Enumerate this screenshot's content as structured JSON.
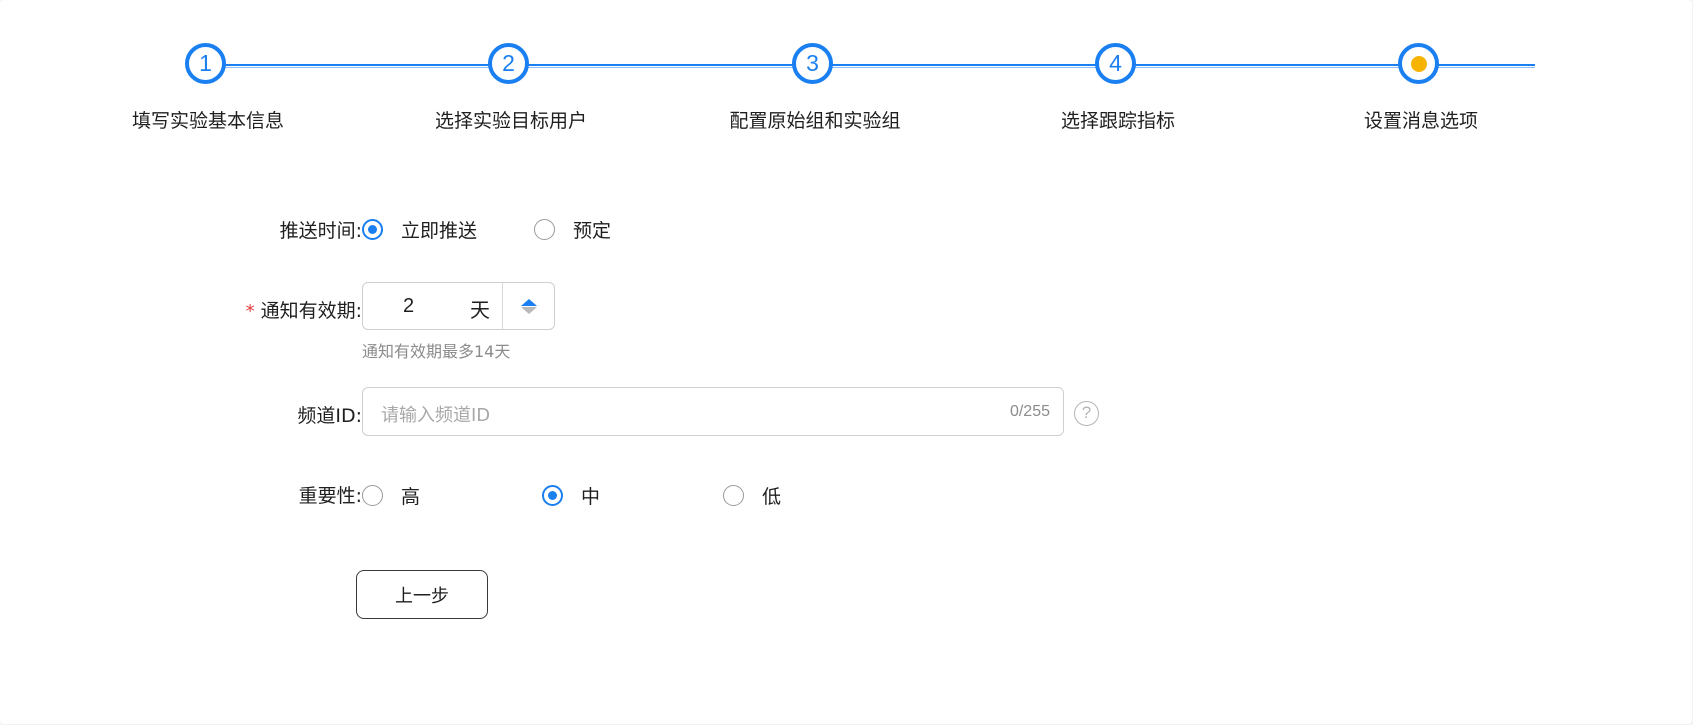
{
  "steps": [
    {
      "number": "1",
      "label": "填写实验基本信息"
    },
    {
      "number": "2",
      "label": "选择实验目标用户"
    },
    {
      "number": "3",
      "label": "配置原始组和实验组"
    },
    {
      "number": "4",
      "label": "选择跟踪指标"
    },
    {
      "number": "",
      "label": "设置消息选项"
    }
  ],
  "form": {
    "push_time": {
      "label": "推送时间:",
      "options": [
        "立即推送",
        "预定"
      ],
      "selected": "立即推送"
    },
    "validity": {
      "required_mark": "*",
      "label": "通知有效期:",
      "value": "2",
      "unit": "天",
      "hint": "通知有效期最多14天"
    },
    "channel_id": {
      "label": "频道ID:",
      "placeholder": "请输入频道ID",
      "char_count": "0/255",
      "help_icon": "?"
    },
    "importance": {
      "label": "重要性:",
      "options": [
        "高",
        "中",
        "低"
      ],
      "selected": "中"
    }
  },
  "buttons": {
    "prev": "上一步"
  },
  "colors": {
    "primary": "#1a7ff0",
    "current_step_dot": "#f6b400",
    "required": "#e23c3c"
  }
}
